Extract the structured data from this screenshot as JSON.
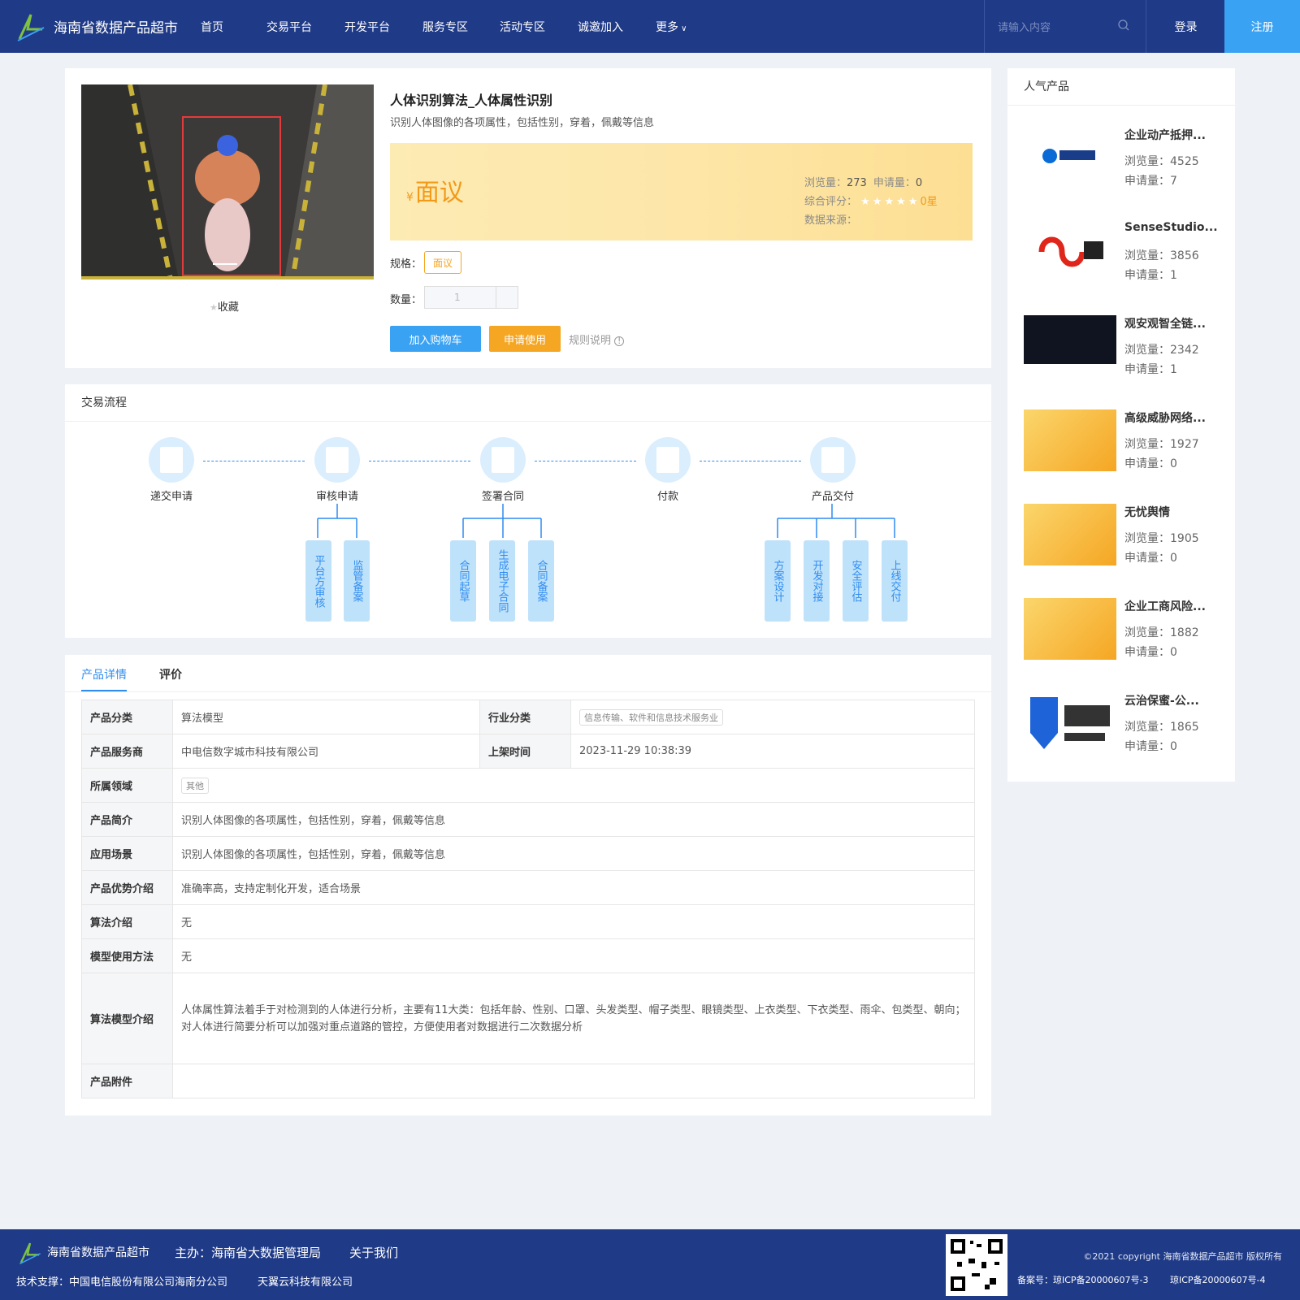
{
  "header": {
    "site_name": "海南省数据产品超市",
    "nav": [
      "首页",
      "交易平台",
      "开发平台",
      "服务专区",
      "活动专区",
      "诚邀加入",
      "更多"
    ],
    "search_placeholder": "请输入内容",
    "login": "登录",
    "register": "注册"
  },
  "product": {
    "title": "人体识别算法_人体属性识别",
    "subtitle": "识别人体图像的各项属性，包括性别，穿着，佩戴等信息",
    "currency": "¥",
    "price": "面议",
    "views_label": "浏览量：",
    "views": "273",
    "apply_label": "申请量：",
    "apply": "0",
    "rating_label": "综合评分：",
    "stars": "★★★★★",
    "rating": "0星",
    "source_label": "数据来源：",
    "favorite": "收藏",
    "spec_label": "规格：",
    "spec_value": "面议",
    "qty_label": "数量：",
    "qty_value": "1",
    "add_cart": "加入购物车",
    "apply_use": "申请使用",
    "rules": "规则说明"
  },
  "process": {
    "title": "交易流程",
    "steps": [
      "递交申请",
      "审核申请",
      "签署合同",
      "付款",
      "产品交付"
    ],
    "sub": {
      "review": [
        "平台方审核",
        "监管备案"
      ],
      "contract": [
        "合同起草",
        "生成电子合同",
        "合同备案"
      ],
      "delivery": [
        "方案设计",
        "开发对接",
        "安全评估",
        "上线交付"
      ]
    }
  },
  "details": {
    "tabs": [
      "产品详情",
      "评价"
    ],
    "rows": {
      "category_k": "产品分类",
      "category_v": "算法模型",
      "industry_k": "行业分类",
      "industry_v": "信息传输、软件和信息技术服务业",
      "provider_k": "产品服务商",
      "provider_v": "中电信数字城市科技有限公司",
      "online_k": "上架时间",
      "online_v": "2023-11-29 10:38:39",
      "domain_k": "所属领域",
      "domain_v": "其他",
      "intro_k": "产品简介",
      "intro_v": "识别人体图像的各项属性，包括性别，穿着，佩戴等信息",
      "scene_k": "应用场景",
      "scene_v": "识别人体图像的各项属性，包括性别，穿着，佩戴等信息",
      "adv_k": "产品优势介绍",
      "adv_v": "准确率高，支持定制化开发，适合场景",
      "algo_k": "算法介绍",
      "algo_v": "无",
      "usage_k": "模型使用方法",
      "usage_v": "无",
      "model_k": "算法模型介绍",
      "model_v": "人体属性算法着手于对检测到的人体进行分析，主要有11大类：包括年龄、性别、口罩、头发类型、帽子类型、眼镜类型、上衣类型、下衣类型、雨伞、包类型、朝向；对人体进行简要分析可以加强对重点道路的管控，方便使用者对数据进行二次数据分析",
      "attach_k": "产品附件"
    }
  },
  "sidebar": {
    "title": "人气产品",
    "items": [
      {
        "name": "企业动产抵押...",
        "views": "浏览量：4525",
        "apply": "申请量：7"
      },
      {
        "name": "SenseStudio...",
        "views": "浏览量：3856",
        "apply": "申请量：1"
      },
      {
        "name": "观安观智全链...",
        "views": "浏览量：2342",
        "apply": "申请量：1"
      },
      {
        "name": "高级威胁网络...",
        "views": "浏览量：1927",
        "apply": "申请量：0"
      },
      {
        "name": "无忧舆情",
        "views": "浏览量：1905",
        "apply": "申请量：0"
      },
      {
        "name": "企业工商风险...",
        "views": "浏览量：1882",
        "apply": "申请量：0"
      },
      {
        "name": "云治保蜜-公...",
        "views": "浏览量：1865",
        "apply": "申请量：0"
      }
    ]
  },
  "footer": {
    "site_name": "海南省数据产品超市",
    "host": "主办：海南省大数据管理局",
    "about": "关于我们",
    "tech": "技术支撑：中国电信股份有限公司海南分公司",
    "tech2": "天翼云科技有限公司",
    "copyright": "©2021 copyright 海南省数据产品超市 版权所有",
    "icp1": "备案号：琼ICP备20000607号-3",
    "icp2": "琼ICP备20000607号-4"
  }
}
